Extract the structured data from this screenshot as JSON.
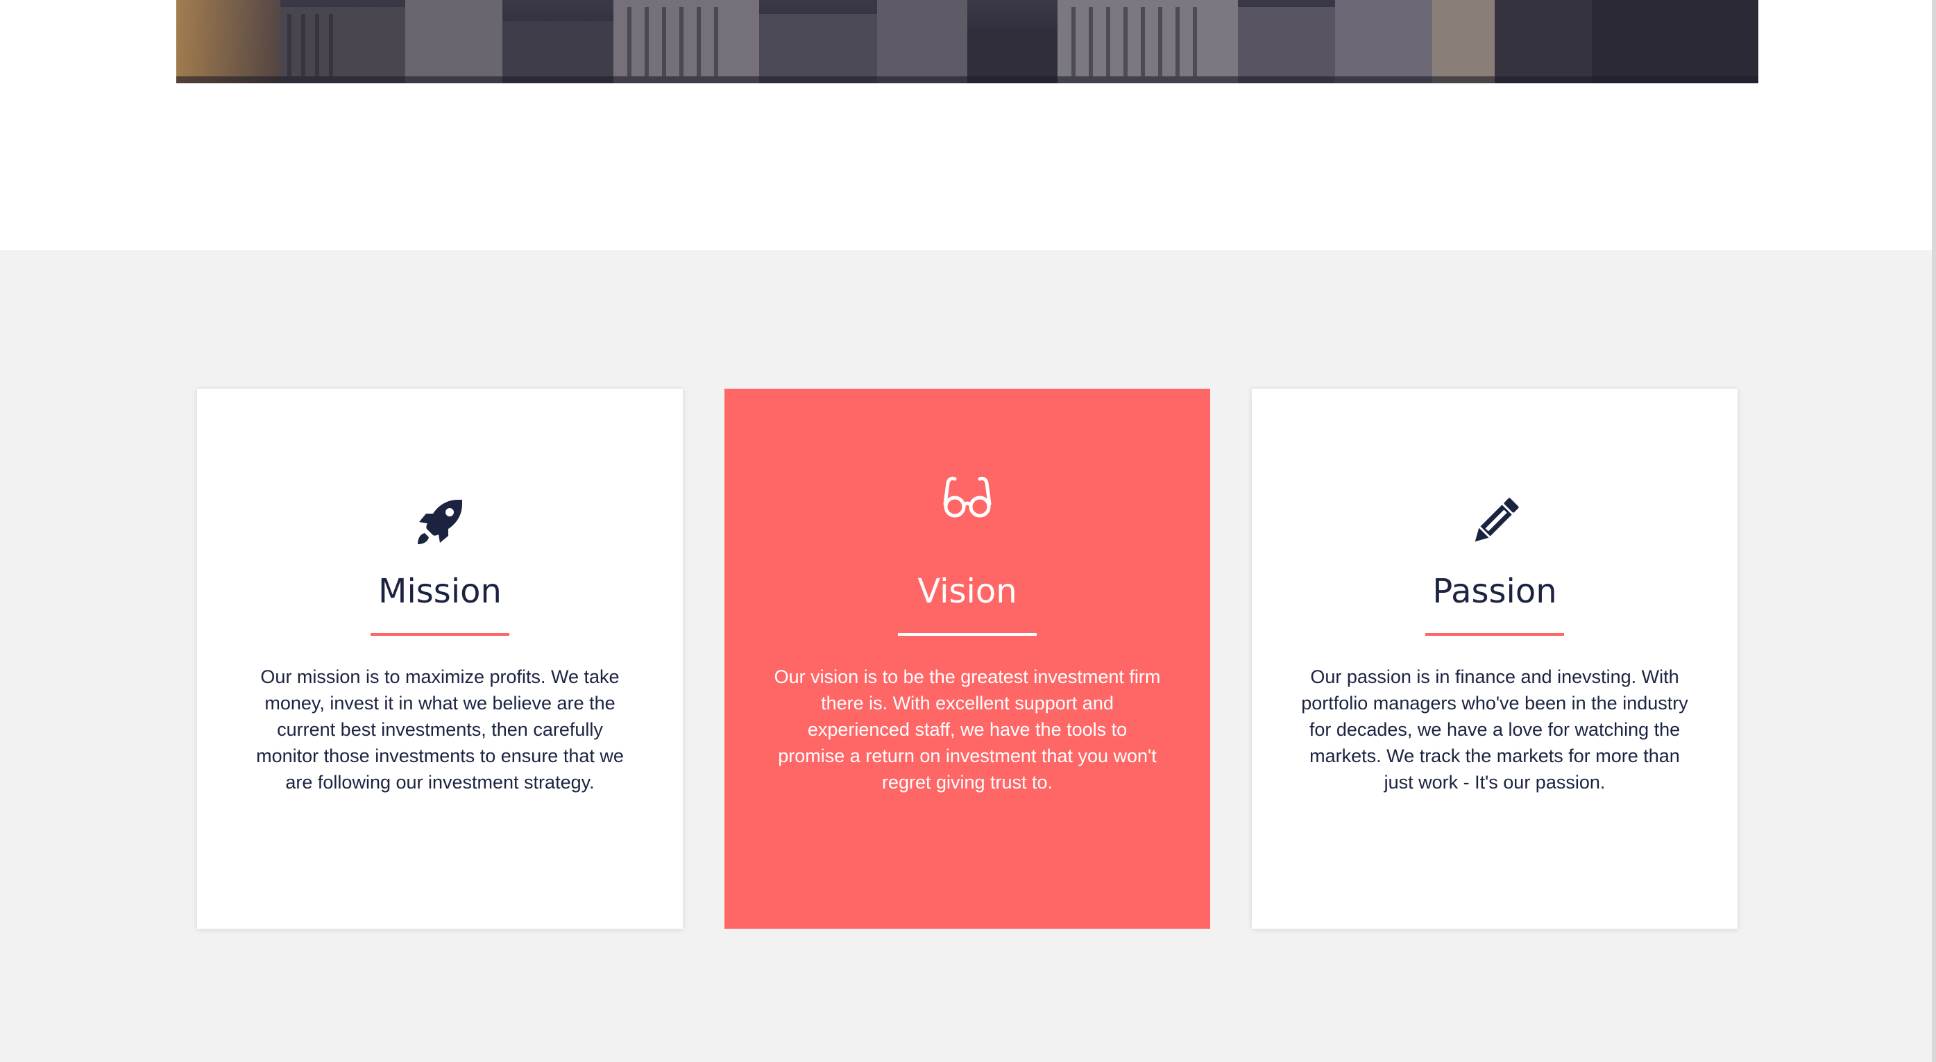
{
  "colors": {
    "accent": "#ff6666",
    "heading": "#1b2340",
    "section_background": "#f2f2f2",
    "card_background": "#ffffff"
  },
  "cards": [
    {
      "title": "Mission",
      "icon": "rocket-icon",
      "text": "Our mission is to maximize profits. We take money, invest it in what we believe are the current best investments, then carefully monitor those investments to ensure that we are following our investment strategy."
    },
    {
      "title": "Vision",
      "icon": "glasses-icon",
      "text": "Our vision is to be the greatest investment firm there is. With excellent support and experienced staff, we have the tools to promise a return on investment that you won't regret giving trust to."
    },
    {
      "title": "Passion",
      "icon": "pencil-icon",
      "text": "Our passion is in finance and inevsting. With portfolio managers who've been in the industry for decades, we have a love for watching the markets. We track the markets for more than just work - It's our passion."
    }
  ]
}
